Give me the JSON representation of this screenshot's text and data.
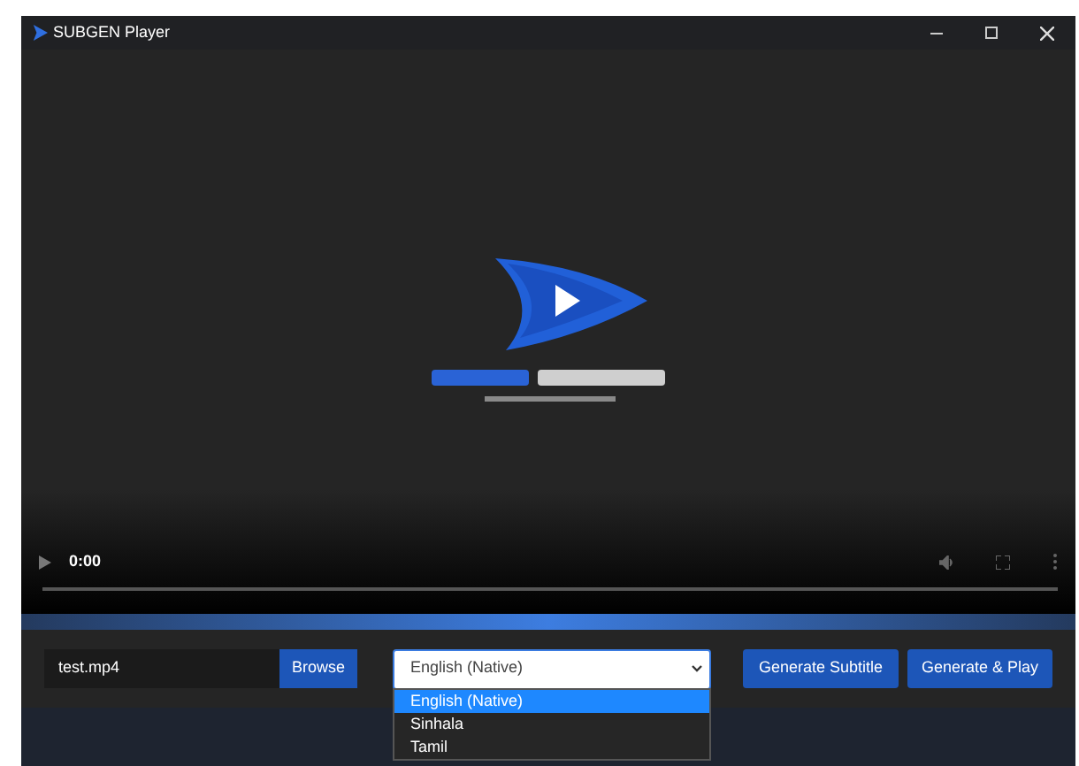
{
  "window": {
    "title": "SUBGEN Player"
  },
  "video": {
    "time": "0:00"
  },
  "file_field": {
    "value": "test.mp4"
  },
  "browse_button": {
    "label": "Browse"
  },
  "language_select": {
    "value": "English (Native)",
    "expanded": true,
    "options": [
      {
        "label": "English (Native)",
        "selected": true
      },
      {
        "label": "Sinhala",
        "selected": false
      },
      {
        "label": "Tamil",
        "selected": false
      }
    ]
  },
  "buttons": [
    {
      "label": "Generate Subtitle"
    },
    {
      "label": "Generate & Play"
    }
  ]
}
